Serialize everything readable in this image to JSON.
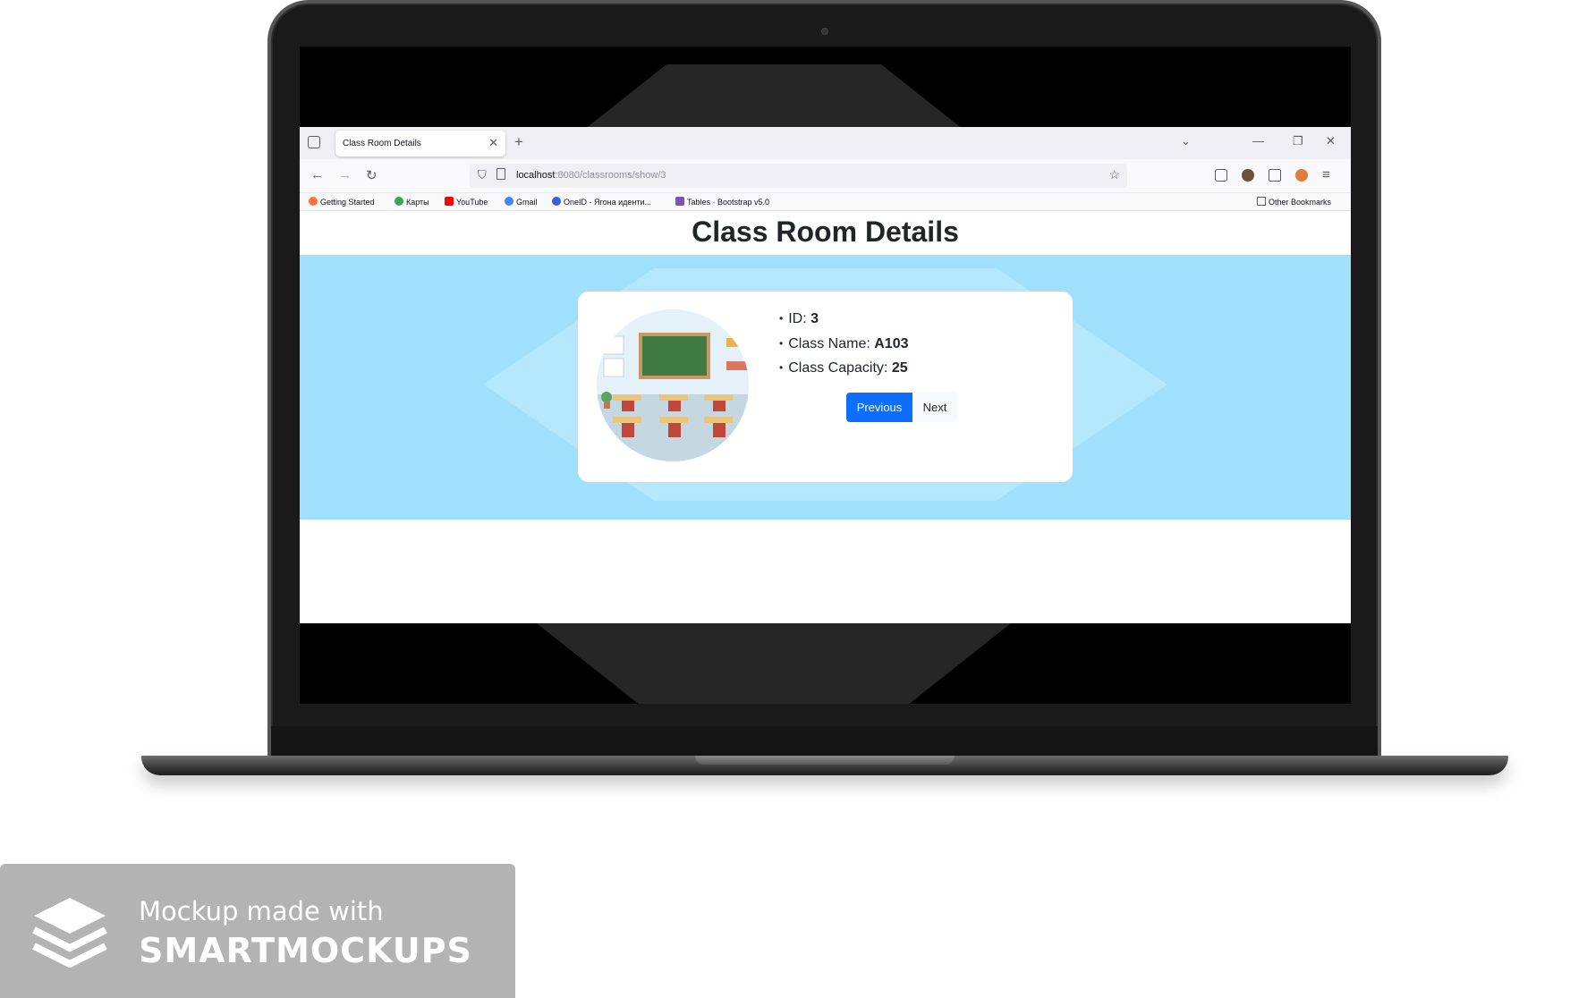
{
  "browser": {
    "tab_title": "Class Room Details",
    "url_host": "localhost",
    "url_path": ":8080/classrooms/show/3",
    "bookmarks": [
      {
        "label": "Getting Started",
        "color": "#ff7139"
      },
      {
        "label": "Карты",
        "color": "#34a853"
      },
      {
        "label": "YouTube",
        "color": "#ff0000"
      },
      {
        "label": "Gmail",
        "color": "#4285f4"
      },
      {
        "label": "OneID - Ягона иденти...",
        "color": "#3b5bdb"
      },
      {
        "label": "Tables · Bootstrap v5.0",
        "color": "#7952b3"
      }
    ],
    "other_bookmarks": "Other Bookmarks"
  },
  "page": {
    "title": "Class Room Details",
    "details": {
      "id_label": "ID:",
      "id_value": "3",
      "name_label": "Class Name:",
      "name_value": "A103",
      "capacity_label": "Class Capacity:",
      "capacity_value": "25"
    },
    "buttons": {
      "previous": "Previous",
      "next": "Next"
    },
    "colors": {
      "hero_bg": "#a0e0fc",
      "primary": "#0d6efd"
    }
  },
  "watermark": {
    "line1": "Mockup made with",
    "line2": "SMARTMOCKUPS"
  }
}
